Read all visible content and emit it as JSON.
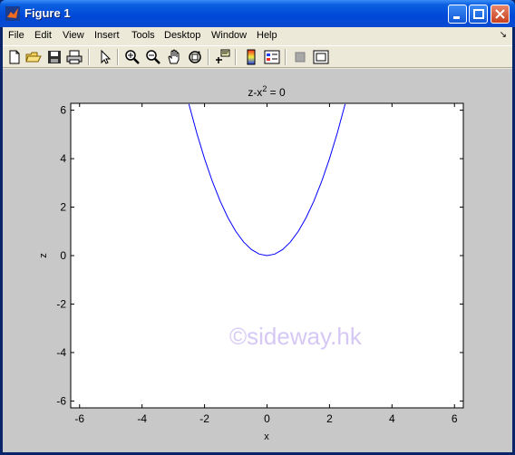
{
  "window": {
    "title": "Figure 1"
  },
  "menu": {
    "items": [
      "File",
      "Edit",
      "View",
      "Insert",
      "Tools",
      "Desktop",
      "Window",
      "Help"
    ]
  },
  "toolbar": {
    "icons": [
      "new-file-icon",
      "open-folder-icon",
      "save-icon",
      "print-icon",
      "pointer-arrow-icon",
      "zoom-in-icon",
      "zoom-out-icon",
      "pan-hand-icon",
      "rotate-3d-icon",
      "data-cursor-icon",
      "colorbar-icon",
      "legend-icon",
      "hide-plot-tools-icon",
      "show-plot-tools-icon"
    ]
  },
  "watermark": "©sideway.hk",
  "chart_data": {
    "type": "line",
    "title": "z-x² = 0",
    "xlabel": "x",
    "ylabel": "z",
    "xlim": [
      -6.2832,
      6.2832
    ],
    "ylim": [
      -6.2832,
      6.2832
    ],
    "xticks": [
      -6,
      -4,
      -2,
      0,
      2,
      4,
      6
    ],
    "yticks": [
      -6,
      -4,
      -2,
      0,
      2,
      4,
      6
    ],
    "grid": false,
    "series": [
      {
        "x": [
          -2.5,
          -2.25,
          -2.0,
          -1.75,
          -1.5,
          -1.25,
          -1.0,
          -0.75,
          -0.5,
          -0.25,
          0,
          0.25,
          0.5,
          0.75,
          1.0,
          1.25,
          1.5,
          1.75,
          2.0,
          2.25,
          2.5
        ],
        "y": [
          6.25,
          5.0625,
          4.0,
          3.0625,
          2.25,
          1.5625,
          1.0,
          0.5625,
          0.25,
          0.0625,
          0,
          0.0625,
          0.25,
          0.5625,
          1.0,
          1.5625,
          2.25,
          3.0625,
          4.0,
          5.0625,
          6.25
        ],
        "color": "#0000ff"
      }
    ]
  },
  "colors": {
    "title_bar": "#0a5fe0",
    "figure_bg": "#c8c8c8",
    "axes_bg": "#ffffff",
    "line": "#0000ff"
  }
}
